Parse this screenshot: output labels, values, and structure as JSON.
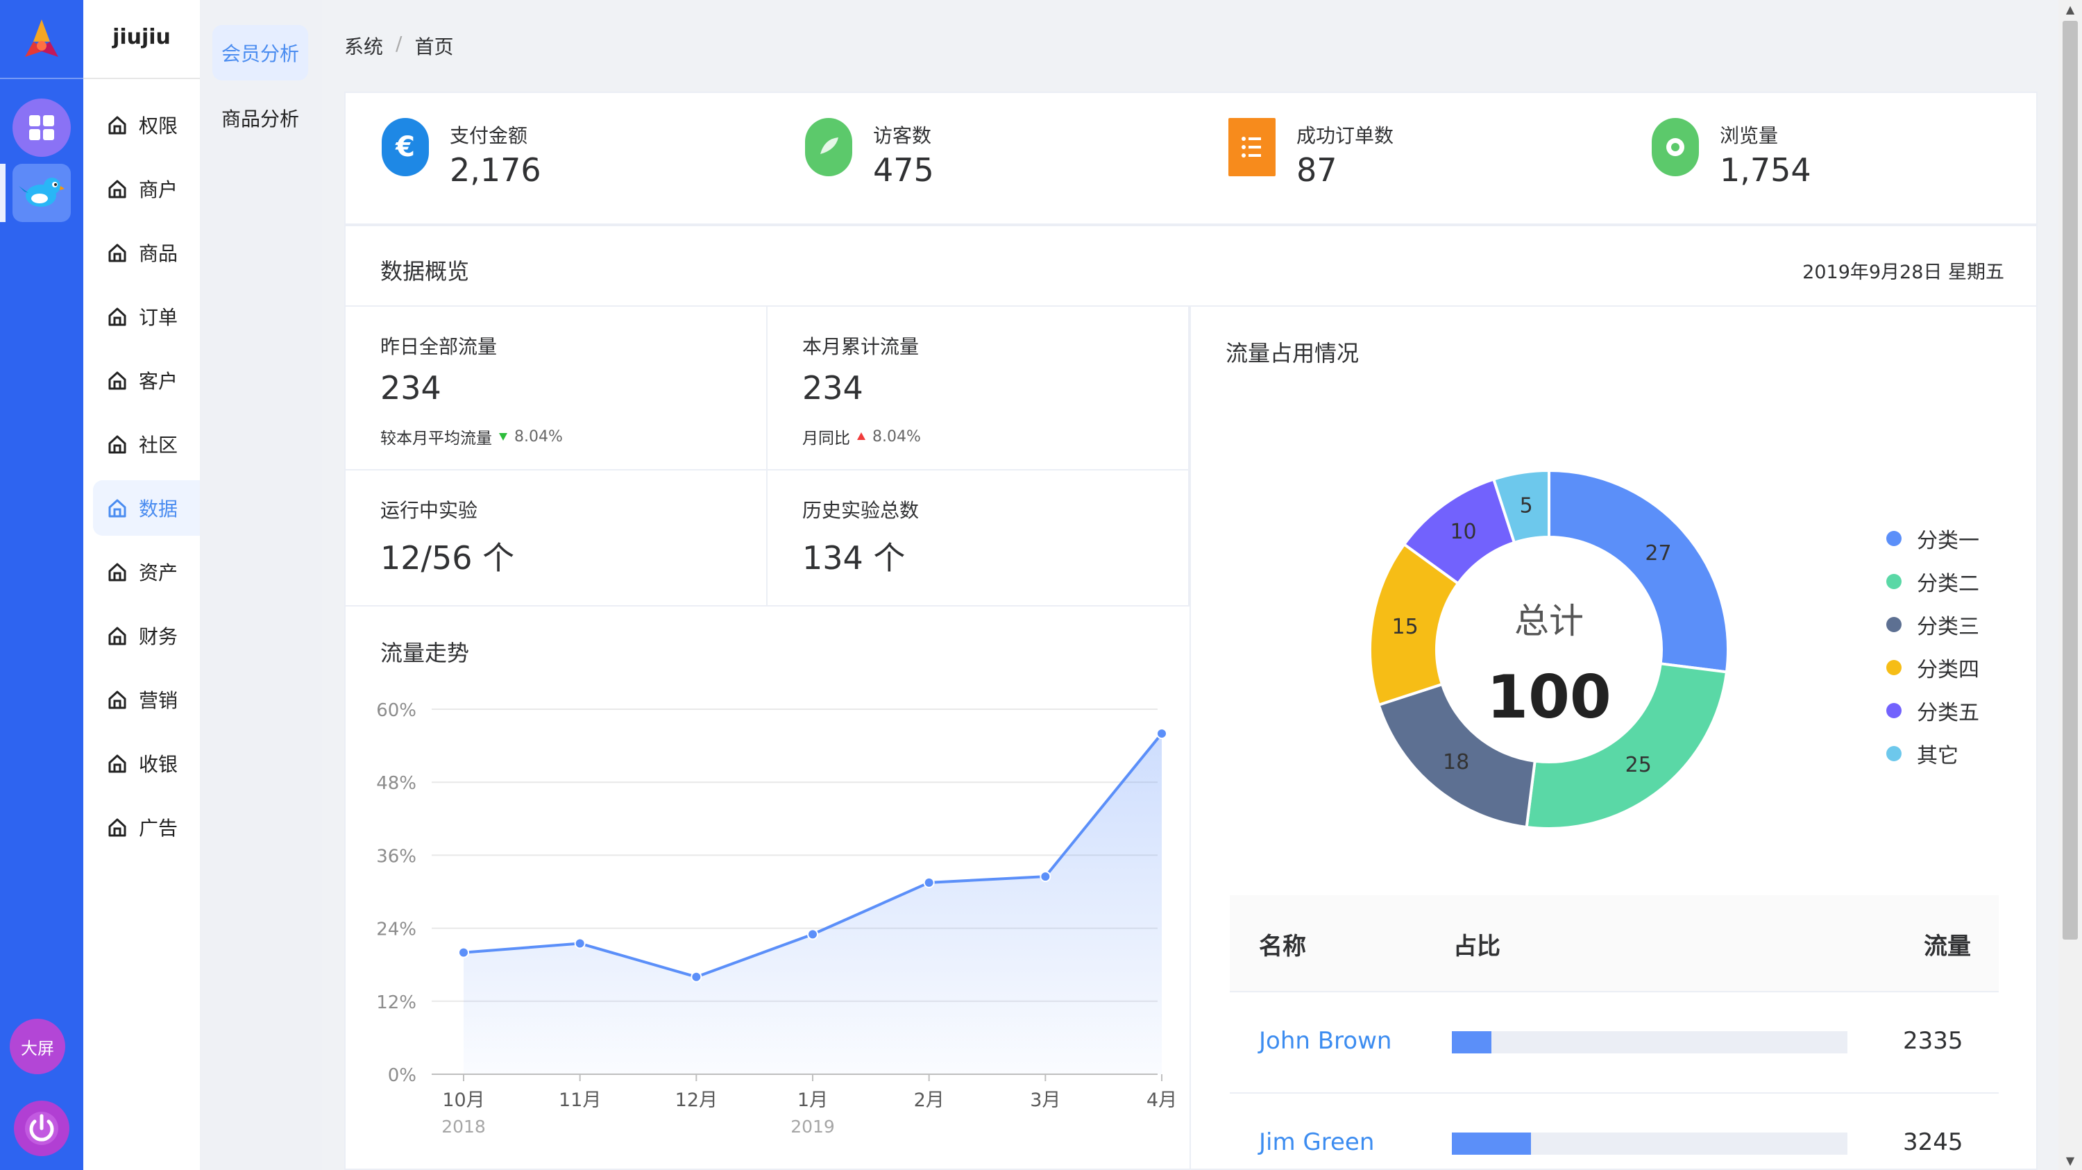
{
  "brand": "jiujiu",
  "rail": {
    "bigscreen_label": "大屏"
  },
  "menu": {
    "items": [
      {
        "label": "权限",
        "active": false
      },
      {
        "label": "商户",
        "active": false
      },
      {
        "label": "商品",
        "active": false
      },
      {
        "label": "订单",
        "active": false
      },
      {
        "label": "客户",
        "active": false
      },
      {
        "label": "社区",
        "active": false
      },
      {
        "label": "数据",
        "active": true
      },
      {
        "label": "资产",
        "active": false
      },
      {
        "label": "财务",
        "active": false
      },
      {
        "label": "营销",
        "active": false
      },
      {
        "label": "收银",
        "active": false
      },
      {
        "label": "广告",
        "active": false
      }
    ]
  },
  "submenu": {
    "items": [
      {
        "label": "会员分析",
        "active": true
      },
      {
        "label": "商品分析",
        "active": false
      }
    ]
  },
  "breadcrumb": [
    "系统",
    "/",
    "首页"
  ],
  "stats": [
    {
      "label": "支付金额",
      "value": "2,176",
      "icon": "euro-icon",
      "color": "#1e88e5"
    },
    {
      "label": "访客数",
      "value": "475",
      "icon": "bird-icon",
      "color": "#5cc96b"
    },
    {
      "label": "成功订单数",
      "value": "87",
      "icon": "list-icon",
      "color": "#f78b1c"
    },
    {
      "label": "浏览量",
      "value": "1,754",
      "icon": "eye-icon",
      "color": "#5cc96b"
    }
  ],
  "overview": {
    "title": "数据概览",
    "date": "2019年9月28日 星期五",
    "metrics": [
      {
        "label": "昨日全部流量",
        "value": "234",
        "note": "较本月平均流量",
        "trend": "down",
        "pct": "8.04%"
      },
      {
        "label": "本月累计流量",
        "value": "234",
        "note": "月同比",
        "trend": "up",
        "pct": "8.04%"
      },
      {
        "label": "运行中实验",
        "value": "12/56 个"
      },
      {
        "label": "历史实验总数",
        "value": "134 个"
      }
    ]
  },
  "trend": {
    "title": "流量走势"
  },
  "donut": {
    "title": "流量占用情况",
    "center_label": "总计",
    "center_value": "100"
  },
  "table": {
    "headers": [
      "名称",
      "占比",
      "流量"
    ],
    "rows": [
      {
        "name": "John Brown",
        "ratio": 0.1,
        "value": "2335"
      },
      {
        "name": "Jim Green",
        "ratio": 0.2,
        "value": "3245"
      }
    ]
  },
  "chart_data": [
    {
      "type": "area",
      "title": "流量走势",
      "x": [
        "10月",
        "11月",
        "12月",
        "1月",
        "2月",
        "3月",
        "4月"
      ],
      "x_sublabels": [
        "2018",
        "",
        "",
        "2019",
        "",
        "",
        ""
      ],
      "series": [
        {
          "values": [
            20,
            21.5,
            16,
            23,
            31.5,
            32.5,
            56
          ]
        }
      ],
      "y_ticks": [
        "0%",
        "12%",
        "24%",
        "36%",
        "48%",
        "60%"
      ],
      "ylim": [
        0,
        60
      ],
      "color": "#5b8ff9"
    },
    {
      "type": "pie",
      "title": "流量占用情况",
      "categories": [
        "分类一",
        "分类二",
        "分类三",
        "分类四",
        "分类五",
        "其它"
      ],
      "values": [
        27,
        25,
        18,
        15,
        10,
        5
      ],
      "colors": [
        "#5b8ff9",
        "#5ad8a6",
        "#5d7092",
        "#f6bd16",
        "#7262fd",
        "#6dc8ec"
      ],
      "total": 100
    }
  ]
}
